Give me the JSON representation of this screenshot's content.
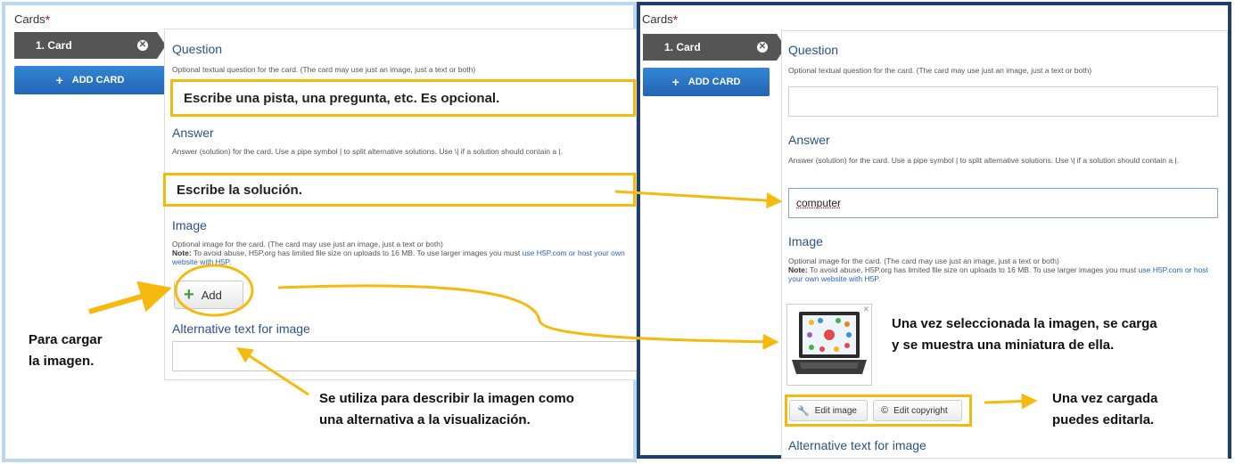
{
  "left": {
    "cards_label": "Cards",
    "required_mark": "*",
    "card_tab": "1. Card",
    "add_card": "ADD CARD",
    "question": {
      "title": "Question",
      "description": "Optional textual question for the card. (The card may use just an image, just a text or both)",
      "overlay_text": "Escribe una pista, una pregunta, etc. Es opcional."
    },
    "answer": {
      "title": "Answer",
      "description": "Answer (solution) for the card. Use a pipe symbol | to split alternative solutions. Use \\| if a solution should contain a |.",
      "overlay_text": "Escribe la solución."
    },
    "image": {
      "title": "Image",
      "description": "Optional image for the card. (The card may use just an image, just a text or both)",
      "note_label": "Note:",
      "note_text": " To avoid abuse, H5P.org has limited file size on uploads to 16 MB. To use larger images you must ",
      "note_link": "use H5P.com or host your own website with H5P.",
      "add_label": "Add"
    },
    "alt_text": {
      "title": "Alternative text for image",
      "value": ""
    }
  },
  "right": {
    "cards_label": "Cards",
    "required_mark": "*",
    "card_tab": "1. Card",
    "add_card": "ADD CARD",
    "question": {
      "title": "Question",
      "description": "Optional textual question for the card. (The card may use just an image, just a text or both)",
      "value": ""
    },
    "answer": {
      "title": "Answer",
      "description": "Answer (solution) for the card. Use a pipe symbol | to split alternative solutions. Use \\| if a solution should contain a |.",
      "value": "computer"
    },
    "image": {
      "title": "Image",
      "description": "Optional image for the card. (The card may use just an image, just a text or both)",
      "note_label": "Note:",
      "note_text": " To avoid abuse, H5P.org has limited file size on uploads to 16 MB. To use larger images you must ",
      "note_link": "use H5P.com or host your own website with H5P.",
      "edit_image": "Edit image",
      "edit_copyright": "Edit copyright"
    },
    "alt_text": {
      "title": "Alternative text for image"
    }
  },
  "annotations": {
    "upload_note_1": "Para cargar",
    "upload_note_2": "la imagen.",
    "alt_note_1": "Se utiliza para describir la imagen como",
    "alt_note_2": "una alternativa a la visualización.",
    "thumb_note_1": "Una vez seleccionada la imagen, se carga",
    "thumb_note_2": "y se muestra una miniatura de ella.",
    "edit_note_1": "Una vez cargada",
    "edit_note_2": "puedes editarla."
  },
  "colors": {
    "highlight": "#f5b90f",
    "heading": "#2a5286",
    "button_blue": "#2266b3",
    "left_border": "#bcd7ee",
    "right_border": "#1f3f6a"
  }
}
